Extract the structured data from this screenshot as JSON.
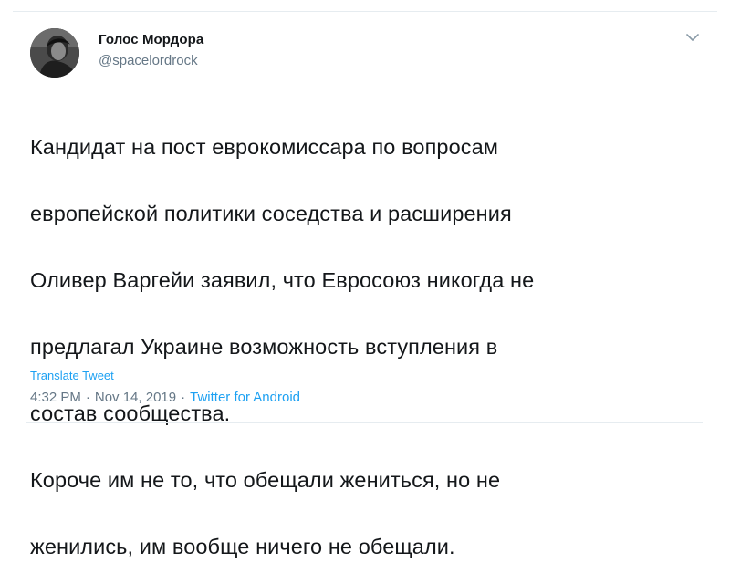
{
  "tweet": {
    "author": {
      "display_name": "Голос Мордора",
      "handle": "@spacelordrock"
    },
    "text_lines": [
      "Кандидат на пост еврокомиссара по вопросам",
      "европейской политики соседства и расширения",
      "Оливер Варгейи заявил, что Евросоюз никогда не",
      "предлагал Украине возможность вступления в",
      "состав сообщества.",
      "Короче им не то, что обещали жениться, но не",
      "женились, им вообще ничего не обещали."
    ],
    "translate_label": "Translate Tweet",
    "time": "4:32 PM",
    "separator": "·",
    "date": "Nov 14, 2019",
    "source": "Twitter for Android"
  },
  "icons": {
    "more_menu": "chevron-down-icon"
  },
  "colors": {
    "text": "#14171a",
    "secondary": "#657786",
    "link": "#1da1f2",
    "border": "#e6ecf0"
  }
}
